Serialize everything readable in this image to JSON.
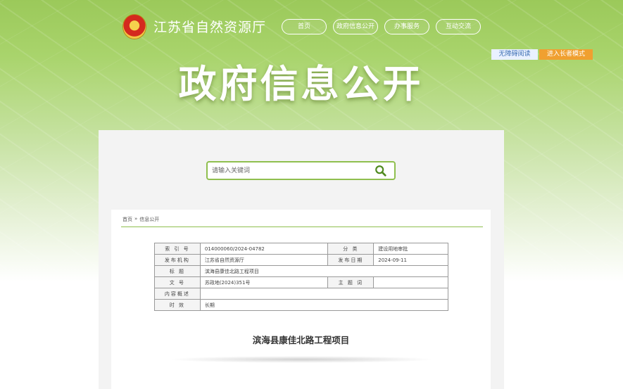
{
  "header": {
    "site_title": "江苏省自然资源厅",
    "nav": [
      "首页",
      "政府信息公开",
      "办事服务",
      "互动交流"
    ],
    "accessibility_label": "无障碍阅读",
    "elder_mode_label": "进入长者模式",
    "banner_title": "政府信息公开",
    "emblem_icon": "national-emblem-icon"
  },
  "search": {
    "placeholder": "请输入关键词",
    "icon": "search-icon",
    "accent_color": "#8fbf4e"
  },
  "breadcrumb": {
    "home": "首页",
    "separator": "»",
    "current": "信息公开"
  },
  "info_table": {
    "index_label": "索 引 号",
    "index_value": "014000060/2024-04782",
    "category_label": "分 类",
    "category_value": "建设用地审批",
    "publisher_label": "发布机构",
    "publisher_value": "江苏省自然资源厅",
    "date_label": "发布日期",
    "date_value": "2024-09-11",
    "title_label": "标 题",
    "title_value": "滨海县康佳北路工程项目",
    "docno_label": "文 号",
    "docno_value": "苏政地(2024)351号",
    "keywords_label": "主 题 词",
    "keywords_value": "",
    "summary_label": "内容概述",
    "summary_value": "",
    "validity_label": "时 效",
    "validity_value": "长期"
  },
  "document": {
    "title": "滨海县康佳北路工程项目"
  }
}
